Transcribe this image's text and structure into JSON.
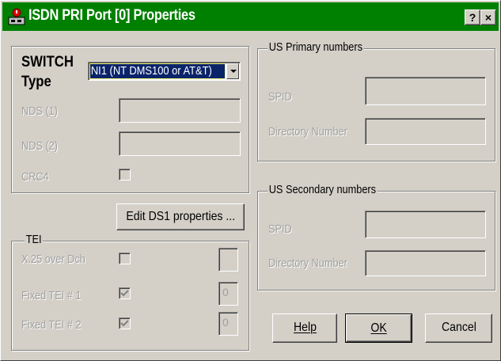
{
  "window": {
    "title": "ISDN PRI Port [0]  Properties",
    "help_button": "?",
    "close_button": "×",
    "title_bar_color": "#008000",
    "face_color": "#d4d0c8",
    "disabled_text_color": "#a0a0a0"
  },
  "switch_group": {
    "label_line1": "SWITCH",
    "label_line2": "Type",
    "switch_type_selected": "NI1 (NT DMS100 or AT&T)",
    "nds1_label": "NDS (1)",
    "nds2_label": "NDS (2)",
    "crc4_label": "CRC4",
    "crc4_checked": false
  },
  "edit_ds1_button": "Edit DS1 properties ...",
  "tei_group": {
    "legend": "TEI",
    "rows": [
      {
        "label": "X.25 over Dch",
        "checked": false,
        "value": ""
      },
      {
        "label": "Fixed TEI # 1",
        "checked": true,
        "value": "0"
      },
      {
        "label": "Fixed TEI # 2",
        "checked": true,
        "value": "0"
      }
    ]
  },
  "us_primary": {
    "legend": "US Primary numbers",
    "spid_label": "SPID",
    "dirnum_label": "Directory Number"
  },
  "us_secondary": {
    "legend": "US Secondary numbers",
    "spid_label": "SPID",
    "dirnum_label": "Directory Number"
  },
  "buttons": {
    "help": "Help",
    "ok": "OK",
    "cancel": "Cancel"
  }
}
